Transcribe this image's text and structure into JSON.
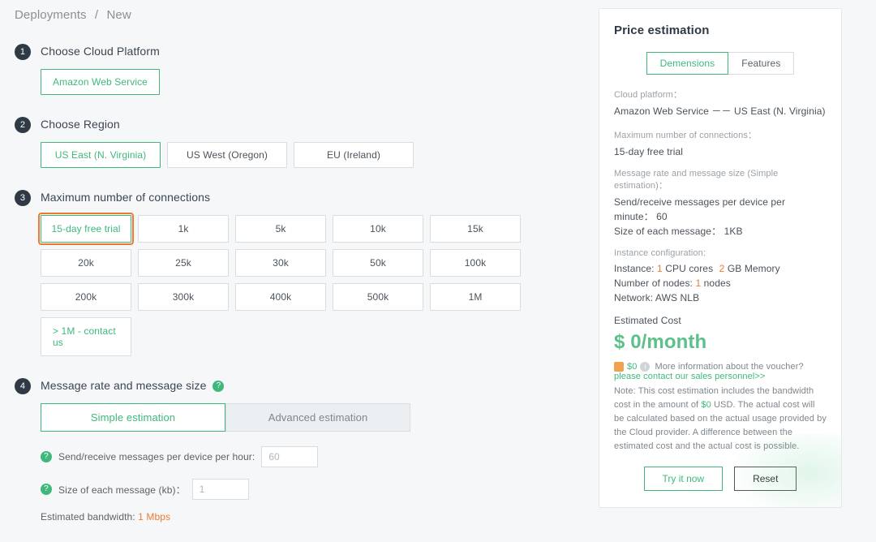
{
  "breadcrumb": {
    "root": "Deployments",
    "sep": "/",
    "current": "New"
  },
  "steps": {
    "s1": {
      "title": "Choose Cloud Platform",
      "options": [
        "Amazon Web Service"
      ],
      "selected": 0
    },
    "s2": {
      "title": "Choose Region",
      "options": [
        "US East (N. Virginia)",
        "US West (Oregon)",
        "EU (Ireland)"
      ],
      "selected": 0
    },
    "s3": {
      "title": "Maximum number of connections",
      "options": [
        "15-day free trial",
        "1k",
        "5k",
        "10k",
        "15k",
        "20k",
        "25k",
        "30k",
        "50k",
        "100k",
        "200k",
        "300k",
        "400k",
        "500k",
        "1M",
        "> 1M - contact us"
      ],
      "selected": 0
    },
    "s4": {
      "title": "Message rate and message size",
      "tabs": [
        "Simple estimation",
        "Advanced estimation"
      ],
      "selected_tab": 0,
      "line_messages": "Send/receive messages per device per hour:",
      "messages_value": "60",
      "line_size": "Size of each message (kb)：",
      "size_value": "1",
      "bandwidth_label": "Estimated bandwidth:",
      "bandwidth_value": "1 Mbps"
    }
  },
  "panel": {
    "title": "Price estimation",
    "tabs": [
      "Demensions",
      "Features"
    ],
    "selected_tab": 0,
    "platform_k": "Cloud platform：",
    "platform_v": "Amazon Web Service －－ US East (N. Virginia)",
    "maxconn_k": "Maximum number of connections：",
    "maxconn_v": "15-day free trial",
    "msg_k": "Message rate and message size (Simple estimation)：",
    "msg_v_prefix": "Send/receive messages per device per minute：",
    "msg_v_value": "60",
    "msg_size_prefix": "Size of each message：",
    "msg_size_value": "1KB",
    "instcfg_k": "Instance configuration:",
    "inst_prefix": "Instance:",
    "inst_cpu": "1",
    "inst_cpu_suffix": "CPU cores",
    "inst_mem": "2",
    "inst_mem_suffix": "GB Memory",
    "nodes_prefix": "Number of nodes:",
    "nodes_value": "1",
    "nodes_suffix": "nodes",
    "network": "Network: AWS NLB",
    "est_label": "Estimated Cost",
    "est_cost": "$ 0/month",
    "voucher_amt": "$0",
    "voucher_info": "More information about the voucher?",
    "voucher_link": "please contact our sales personnel>>",
    "note_prefix": "Note: This cost estimation includes the bandwidth cost in the amount of ",
    "note_amount": "$0",
    "note_suffix": " USD. The actual cost will be calculated based on the actual usage provided by the Cloud provider. A difference between the estimated cost and the actual cost is possible.",
    "try": "Try it now",
    "reset": "Reset"
  }
}
